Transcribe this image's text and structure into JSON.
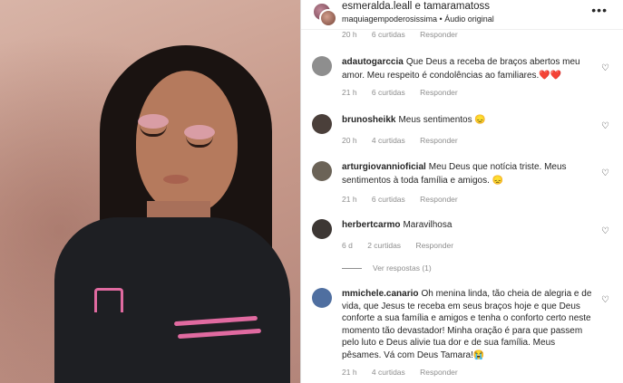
{
  "post": {
    "author_line": "esmeralda.leall e tamaramatoss",
    "audio_line": "maquiagempoderosissima • Áudio original",
    "more_icon": "more-horizontal-icon"
  },
  "clipped_meta": {
    "time": "20 h",
    "likes": "6 curtidas",
    "reply": "Responder"
  },
  "comments": [
    {
      "username": "adautogarccia",
      "text": "Que Deus a receba de braços abertos meu amor. Meu respeito é condolências ao familiares.❤️❤️",
      "time": "21 h",
      "likes": "6 curtidas",
      "reply": "Responder",
      "avatar_color": "#8e8e8e"
    },
    {
      "username": "brunosheikk",
      "text": "Meus sentimentos 😞",
      "time": "20 h",
      "likes": "4 curtidas",
      "reply": "Responder",
      "avatar_color": "#4a3f3a"
    },
    {
      "username": "arturgiovannioficial",
      "text": "Meu Deus que notícia triste. Meus sentimentos à toda família e amigos. 😞",
      "time": "21 h",
      "likes": "6 curtidas",
      "reply": "Responder",
      "avatar_color": "#6b6357"
    },
    {
      "username": "herbertcarmo",
      "text": "Maravilhosa",
      "time": "6 d",
      "likes": "2 curtidas",
      "reply": "Responder",
      "avatar_color": "#3d3734"
    },
    {
      "username": "mmichele.canario",
      "text": "Oh menina linda, tão cheia de alegria e de vida, que Jesus te receba em seus braços hoje e que Deus conforte a sua família e amigos e tenha o conforto certo neste momento tão devastador! Minha oração é para que passem pelo luto e Deus alivie tua dor e de sua família. Meus pêsames. Vá com Deus Tamara!😭",
      "time": "21 h",
      "likes": "4 curtidas",
      "reply": "Responder",
      "avatar_color": "#4f6fa0"
    }
  ],
  "view_replies": "Ver respostas (1)",
  "icons": {
    "heart": "heart-outline-icon"
  }
}
